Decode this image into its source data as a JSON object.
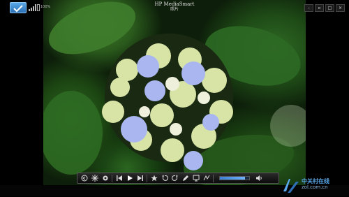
{
  "window": {
    "title": "HP MediaSmart",
    "subtitle": "照片",
    "battery_label": "100%"
  },
  "controls": {
    "volume_level": 0.85,
    "buttons": [
      "back-icon",
      "settings-gear-icon",
      "options-gear-icon",
      "previous-icon",
      "play-icon",
      "next-icon",
      "favorite-star-icon",
      "rotate-left-icon",
      "rotate-right-icon",
      "edit-icon",
      "slideshow-icon",
      "share-icon",
      "speaker-icon"
    ]
  },
  "watermark": {
    "main": "中关村在线",
    "sub": "zol.com.cn"
  },
  "colors": {
    "accent": "#3c7fd6",
    "flower_blue": "#9aa8e8",
    "flower_green": "#d9e6a8"
  }
}
